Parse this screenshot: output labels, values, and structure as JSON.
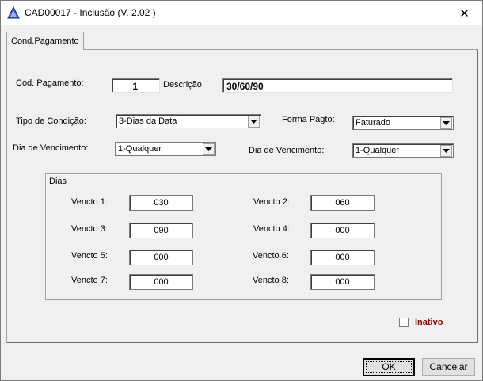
{
  "window": {
    "title": "CAD00017 - Inclusão  (V.  2.02 )",
    "close_icon": "✕"
  },
  "tabs": [
    {
      "label": "Cond.Pagamento",
      "active": true
    }
  ],
  "form": {
    "cod_pagamento_label": "Cod. Pagamento:",
    "cod_pagamento_value": "1",
    "descricao_label": "Descrição",
    "descricao_value": "30/60/90",
    "tipo_condicao_label": "Tipo de Condição:",
    "tipo_condicao_value": "3-Dias da Data",
    "forma_pagto_label": "Forma Pagto:",
    "forma_pagto_value": "Faturado",
    "dia_vencimento_label_1": "Dia de Vencimento:",
    "dia_vencimento_value_1": "1-Qualquer",
    "dia_vencimento_label_2": "Dia de Vencimento:",
    "dia_vencimento_value_2": "1-Qualquer"
  },
  "dias": {
    "title": "Dias",
    "items": [
      {
        "label": "Vencto 1:",
        "value": "030"
      },
      {
        "label": "Vencto 2:",
        "value": "060"
      },
      {
        "label": "Vencto 3:",
        "value": "090"
      },
      {
        "label": "Vencto 4:",
        "value": "000"
      },
      {
        "label": "Vencto 5:",
        "value": "000"
      },
      {
        "label": "Vencto 6:",
        "value": "000"
      },
      {
        "label": "Vencto 7:",
        "value": "000"
      },
      {
        "label": "Vencto 8:",
        "value": "000"
      }
    ]
  },
  "inativo": {
    "label": "Inativo",
    "checked": false,
    "color": "#8b0000"
  },
  "buttons": {
    "ok_underlined": "O",
    "ok_rest": "K",
    "cancelar_underlined": "C",
    "cancelar_rest": "ancelar"
  },
  "icons": {
    "app": "triangle-app-icon",
    "combo_arrow": "chevron-down-icon"
  }
}
